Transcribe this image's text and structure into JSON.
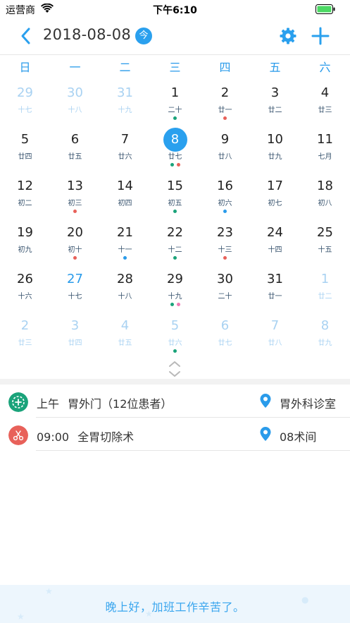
{
  "status_bar": {
    "carrier": "运营商",
    "time": "下午6:10"
  },
  "header": {
    "date": "2018-08-08",
    "today_label": "今"
  },
  "weekdays": [
    "日",
    "一",
    "二",
    "三",
    "四",
    "五",
    "六"
  ],
  "colors": {
    "accent": "#2aa0ee",
    "dot_green": "#1aa37a",
    "dot_red": "#e8615a",
    "dot_blue": "#2a9bea",
    "dot_pink": "#f07ab4"
  },
  "weeks": [
    [
      {
        "day": "29",
        "lunar": "十七",
        "other": true,
        "dots": []
      },
      {
        "day": "30",
        "lunar": "十八",
        "other": true,
        "dots": []
      },
      {
        "day": "31",
        "lunar": "十九",
        "other": true,
        "dots": []
      },
      {
        "day": "1",
        "lunar": "二十",
        "dots": [
          "green"
        ]
      },
      {
        "day": "2",
        "lunar": "廿一",
        "dots": [
          "red"
        ]
      },
      {
        "day": "3",
        "lunar": "廿二",
        "dots": []
      },
      {
        "day": "4",
        "lunar": "廿三",
        "dots": []
      }
    ],
    [
      {
        "day": "5",
        "lunar": "廿四",
        "dots": []
      },
      {
        "day": "6",
        "lunar": "廿五",
        "dots": []
      },
      {
        "day": "7",
        "lunar": "廿六",
        "dots": []
      },
      {
        "day": "8",
        "lunar": "廿七",
        "selected": true,
        "dots": [
          "green",
          "red"
        ]
      },
      {
        "day": "9",
        "lunar": "廿八",
        "dots": []
      },
      {
        "day": "10",
        "lunar": "廿九",
        "dots": []
      },
      {
        "day": "11",
        "lunar": "七月",
        "dots": []
      }
    ],
    [
      {
        "day": "12",
        "lunar": "初二",
        "dots": []
      },
      {
        "day": "13",
        "lunar": "初三",
        "dots": [
          "red"
        ]
      },
      {
        "day": "14",
        "lunar": "初四",
        "dots": []
      },
      {
        "day": "15",
        "lunar": "初五",
        "dots": [
          "green"
        ]
      },
      {
        "day": "16",
        "lunar": "初六",
        "dots": [
          "blue"
        ]
      },
      {
        "day": "17",
        "lunar": "初七",
        "dots": []
      },
      {
        "day": "18",
        "lunar": "初八",
        "dots": []
      }
    ],
    [
      {
        "day": "19",
        "lunar": "初九",
        "dots": []
      },
      {
        "day": "20",
        "lunar": "初十",
        "dots": [
          "red"
        ]
      },
      {
        "day": "21",
        "lunar": "十一",
        "dots": [
          "blue"
        ]
      },
      {
        "day": "22",
        "lunar": "十二",
        "dots": [
          "green"
        ]
      },
      {
        "day": "23",
        "lunar": "十三",
        "dots": [
          "red"
        ]
      },
      {
        "day": "24",
        "lunar": "十四",
        "dots": []
      },
      {
        "day": "25",
        "lunar": "十五",
        "dots": []
      }
    ],
    [
      {
        "day": "26",
        "lunar": "十六",
        "dots": []
      },
      {
        "day": "27",
        "lunar": "十七",
        "blue": true,
        "dots": []
      },
      {
        "day": "28",
        "lunar": "十八",
        "dots": []
      },
      {
        "day": "29",
        "lunar": "十九",
        "dots": [
          "green",
          "pink"
        ]
      },
      {
        "day": "30",
        "lunar": "二十",
        "dots": []
      },
      {
        "day": "31",
        "lunar": "廿一",
        "dots": []
      },
      {
        "day": "1",
        "lunar": "廿二",
        "other": true,
        "dots": []
      }
    ],
    [
      {
        "day": "2",
        "lunar": "廿三",
        "other": true,
        "dots": []
      },
      {
        "day": "3",
        "lunar": "廿四",
        "other": true,
        "dots": []
      },
      {
        "day": "4",
        "lunar": "廿五",
        "other": true,
        "dots": []
      },
      {
        "day": "5",
        "lunar": "廿六",
        "other": true,
        "dots": [
          "green"
        ]
      },
      {
        "day": "6",
        "lunar": "廿七",
        "other": true,
        "dots": []
      },
      {
        "day": "7",
        "lunar": "廿八",
        "other": true,
        "dots": []
      },
      {
        "day": "8",
        "lunar": "廿九",
        "other": true,
        "dots": []
      }
    ]
  ],
  "events": [
    {
      "icon": "clinic-icon",
      "icon_color": "#1aa37a",
      "time": "上午",
      "title": "胃外门（12位患者）",
      "location": "胃外科诊室"
    },
    {
      "icon": "scissors-icon",
      "icon_color": "#e8615a",
      "time": "09:00",
      "title": "全胃切除术",
      "location": "08术间"
    }
  ],
  "footer": {
    "message": "晚上好，加班工作辛苦了。"
  }
}
